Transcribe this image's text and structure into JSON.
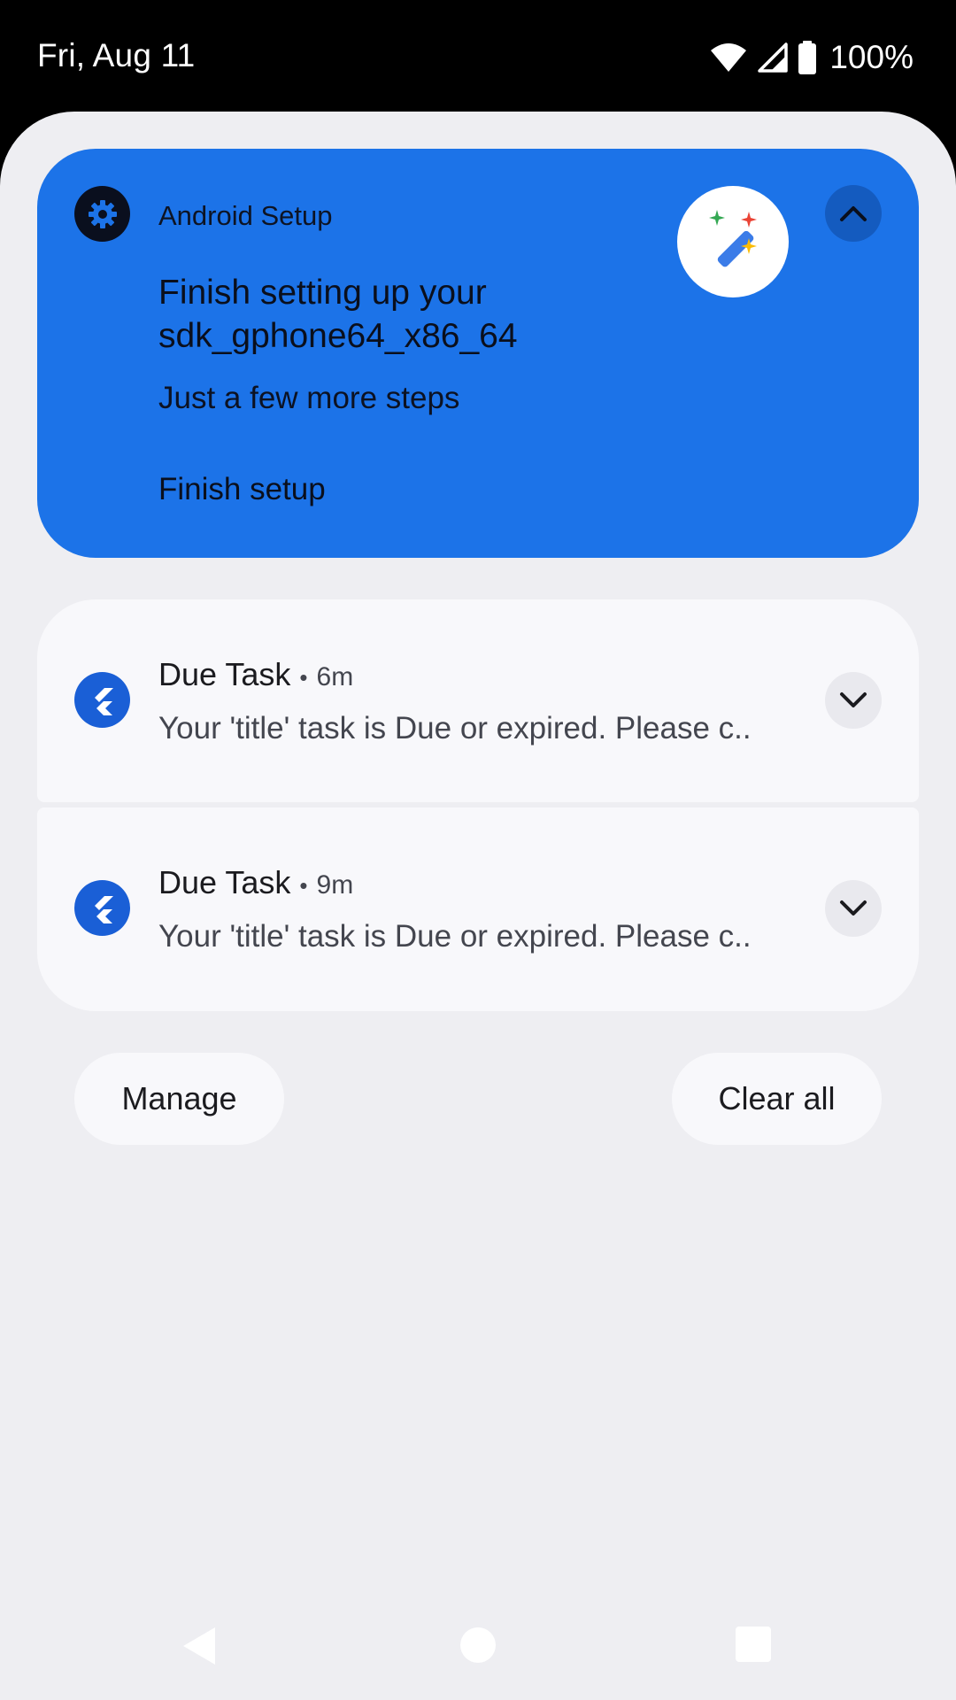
{
  "status_bar": {
    "date": "Fri, Aug 11",
    "battery_percent": "100%",
    "icons": [
      "wifi-icon",
      "signal-icon",
      "battery-icon"
    ]
  },
  "setup_notification": {
    "app_name": "Android Setup",
    "title": "Finish setting up your sdk_gphone64_x86_64",
    "subtitle": "Just a few more steps",
    "action": "Finish setup",
    "app_icon": "gear-icon",
    "large_icon": "magic-wand-icon",
    "background_color": "#1c73e8"
  },
  "notifications": [
    {
      "title": "Due Task",
      "separator": "•",
      "time": "6m",
      "text": "Your 'title' task is Due or expired. Please c..",
      "icon": "flutter-icon"
    },
    {
      "title": "Due Task",
      "separator": "•",
      "time": "9m",
      "text": "Your 'title' task is Due or expired. Please c..",
      "icon": "flutter-icon"
    }
  ],
  "footer": {
    "manage_label": "Manage",
    "clear_all_label": "Clear all"
  },
  "navigation": {
    "buttons": [
      "back-icon",
      "home-icon",
      "recents-icon"
    ]
  }
}
